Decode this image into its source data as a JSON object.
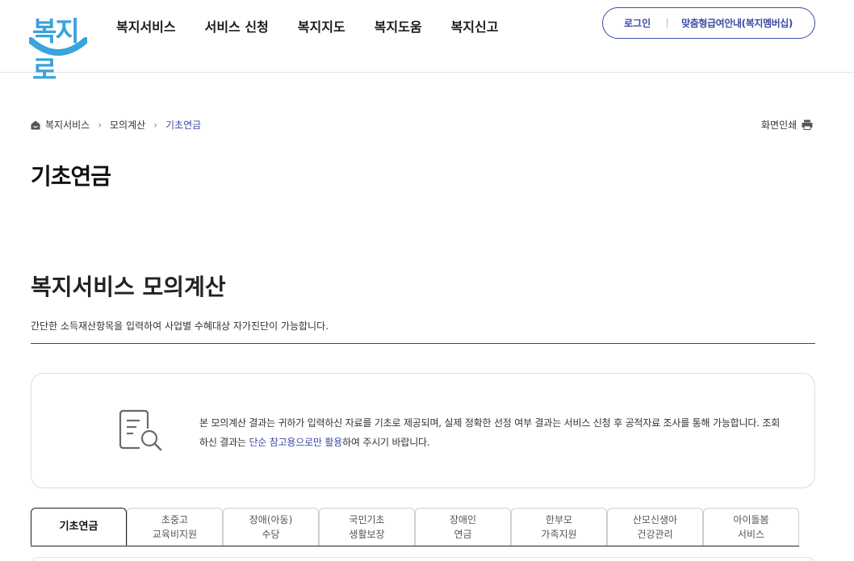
{
  "header": {
    "logo_text": "복지로",
    "nav": [
      "복지서비스",
      "서비스 신청",
      "복지지도",
      "복지도움",
      "복지신고"
    ],
    "login_label": "로그인",
    "guide_label": "맞춤형급여안내(복지멤버십)"
  },
  "breadcrumb": {
    "items": [
      "복지서비스",
      "모의계산",
      "기초연금"
    ],
    "print_label": "화면인쇄"
  },
  "page_title": "기초연금",
  "section": {
    "title": "복지서비스 모의계산",
    "description": "간단한 소득재산항목을 입력하여 사업별 수혜대상 자가진단이 가능합니다."
  },
  "notice": {
    "text_before": "본 모의계산 결과는 귀하가 입력하신 자료를 기초로 제공되며, 실제 정확한 선정 여부 결과는 서비스 신청 후 공적자료 조사를 통해 가능합니다. 조회하신 결과는 ",
    "highlight": "단순 참고용으로만 활용",
    "text_after": "하여 주시기 바랍니다."
  },
  "tabs": [
    {
      "label": "기초연금"
    },
    {
      "label": "초중고\n교육비지원"
    },
    {
      "label": "장애(아동)\n수당"
    },
    {
      "label": "국민기초\n생활보장"
    },
    {
      "label": "장애인\n연금"
    },
    {
      "label": "한부모\n가족지원"
    },
    {
      "label": "산모신생아\n건강관리"
    },
    {
      "label": "아이돌봄\n서비스"
    }
  ],
  "colors": {
    "brand_blue": "#3aa2dd",
    "accent": "#3c4ba6",
    "section_line": "#1f4f7a"
  }
}
